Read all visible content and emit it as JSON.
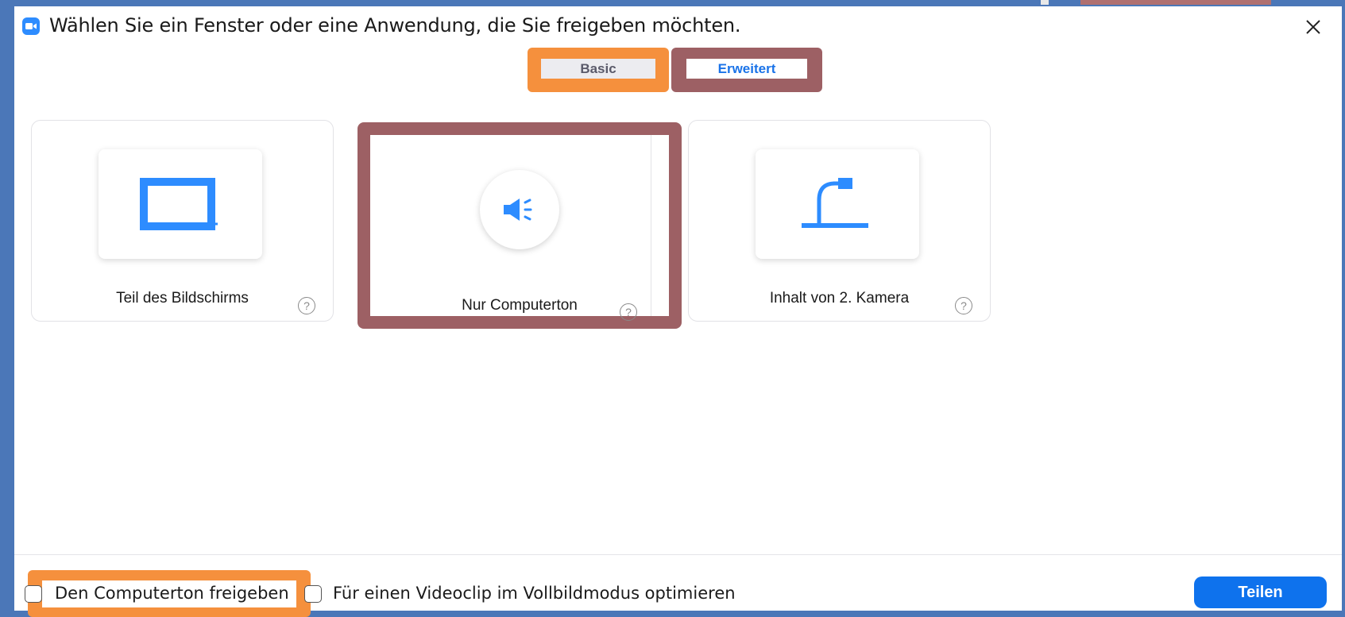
{
  "dialog": {
    "title": "Wählen Sie ein Fenster oder eine Anwendung, die Sie freigeben möchten.",
    "close_icon": "close-icon"
  },
  "tabs": [
    {
      "label": "Basic",
      "active": false
    },
    {
      "label": "Erweitert",
      "active": true
    }
  ],
  "options": [
    {
      "label": "Teil des Bildschirms",
      "icon": "screen-portion-icon",
      "help": "?"
    },
    {
      "label": "Nur Computerton",
      "icon": "speaker-icon",
      "help": "?"
    },
    {
      "label": "Inhalt von 2. Kamera",
      "icon": "document-camera-icon",
      "help": "?"
    }
  ],
  "footer": {
    "share_audio_label": "Den Computerton freigeben",
    "optimize_video_label": "Für einen Videoclip im Vollbildmodus optimieren",
    "share_button": "Teilen"
  },
  "colors": {
    "accent": "#0e72ed",
    "highlight_orange": "#f5903d",
    "highlight_maroon": "#9d6064",
    "icon_blue": "#2d8cff"
  }
}
